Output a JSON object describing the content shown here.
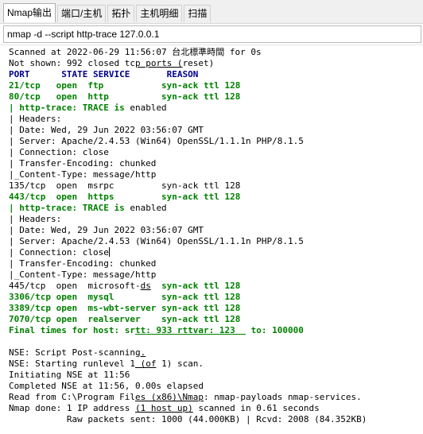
{
  "tabs": [
    {
      "label": "Nmap输出",
      "active": true
    },
    {
      "label": "端口/主机",
      "active": false
    },
    {
      "label": "拓扑",
      "active": false
    },
    {
      "label": "主机明细",
      "active": false
    },
    {
      "label": "扫描",
      "active": false
    }
  ],
  "command": {
    "value": "nmap -d --script http-trace 127.0.0.1"
  },
  "output": {
    "scanned": "Scanned at 2022-06-29 11:56:07 台北標準時間 for 0s",
    "not_shown_a": "Not shown: 992 closed tc",
    "not_shown_b": "p ports (",
    "not_shown_c": "reset)",
    "header": "PORT      STATE SERVICE       REASON",
    "p21": "21/tcp   open  ftp           syn-ack ttl 128",
    "p80": "80/tcp   open  http          syn-ack ttl 128",
    "t1_1": "| http-trace: TRACE is",
    "t1_1b": " enabled",
    "t1_2": "| Headers:",
    "t1_3": "| Date: Wed, 29 Jun 2022 03:56:07 GMT",
    "t1_4": "| Server: Apache/2.4.53 (Win64) OpenSSL/1.1.1n PHP/8.1.5",
    "t1_5": "| Connection: close",
    "t1_6": "| Transfer-Encoding: chunked",
    "t1_7": "|_Content-Type: message/http",
    "p135": "135/tcp  open  msrpc         syn-ack ttl 128",
    "p443": "443/tcp  open  https         syn-ack ttl 128",
    "t2_1": "| http-trace: TRACE is",
    "t2_1b": " enabled",
    "t2_2": "| Headers:",
    "t2_3": "| Date: Wed, 29 Jun 2022 03:56:07 GMT",
    "t2_4": "| Server: Apache/2.4.53 (Win64) OpenSSL/1.1.1n PHP/8.1.5",
    "t2_5": "| Connection: close",
    "t2_6": "| Transfer-Encoding: chunked",
    "t2_7": "|_Content-Type: message/http",
    "p445_a": "445/tcp  open  microsoft-",
    "p445_b": "ds",
    "p445_c": "  syn-ack ttl 128",
    "p3306": "3306/tcp open  mysql         syn-ack ttl 128",
    "p3389": "3389/tcp open  ms-wbt-server syn-ack ttl 128",
    "p7070": "7070/tcp open  realserver    syn-ack ttl 128",
    "final_a": "Final times for host: sr",
    "final_b": "tt: 933 rttvar: 123  ",
    "final_c": " to: 100000",
    "nse1_a": "NSE: Script Post-scanning",
    "nse1_b": ".",
    "nse2_a": "NSE: Starting runlevel 1",
    "nse2_b": " (of",
    "nse2_c": " 1) scan.",
    "init": "Initiating NSE at 11:56",
    "completed": "Completed NSE at 11:56, 0.00s elapsed",
    "read_a": "Read from C:\\Program Fil",
    "read_b": "es (x86)\\Nmap",
    "read_c": ": nmap-payloads nmap-services.",
    "done_a": "Nmap done: 1 IP address ",
    "done_b": "(1 host up)",
    "done_c": " scanned in 0.61 seconds",
    "raw": "           Raw packets sent: 1000 (44.000KB) | Rcvd: 2008 (84.352KB)"
  }
}
